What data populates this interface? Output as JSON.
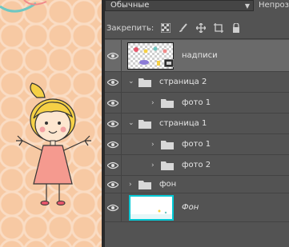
{
  "toolbar": {
    "blend_mode": "Обычные",
    "opacity_label": "Непрозр",
    "lock_label": "Закрепить:"
  },
  "layers": [
    {
      "name": "надписи",
      "type": "layer",
      "selected": true
    },
    {
      "name": "страница 2",
      "type": "group",
      "expanded": true
    },
    {
      "name": "фото 1",
      "type": "group",
      "expanded": false,
      "indent": 1
    },
    {
      "name": "страница 1",
      "type": "group",
      "expanded": true
    },
    {
      "name": "фото 1",
      "type": "group",
      "expanded": false,
      "indent": 1
    },
    {
      "name": "фото 2",
      "type": "group",
      "expanded": false,
      "indent": 1
    },
    {
      "name": "фон",
      "type": "group",
      "expanded": false
    },
    {
      "name": "Фон",
      "type": "background"
    }
  ],
  "colors": {
    "panel_bg": "#535353",
    "selected_row": "#6a6a6a",
    "canvas_bg": "#f7c9a3",
    "thumb_highlight": "#00c8d4"
  }
}
